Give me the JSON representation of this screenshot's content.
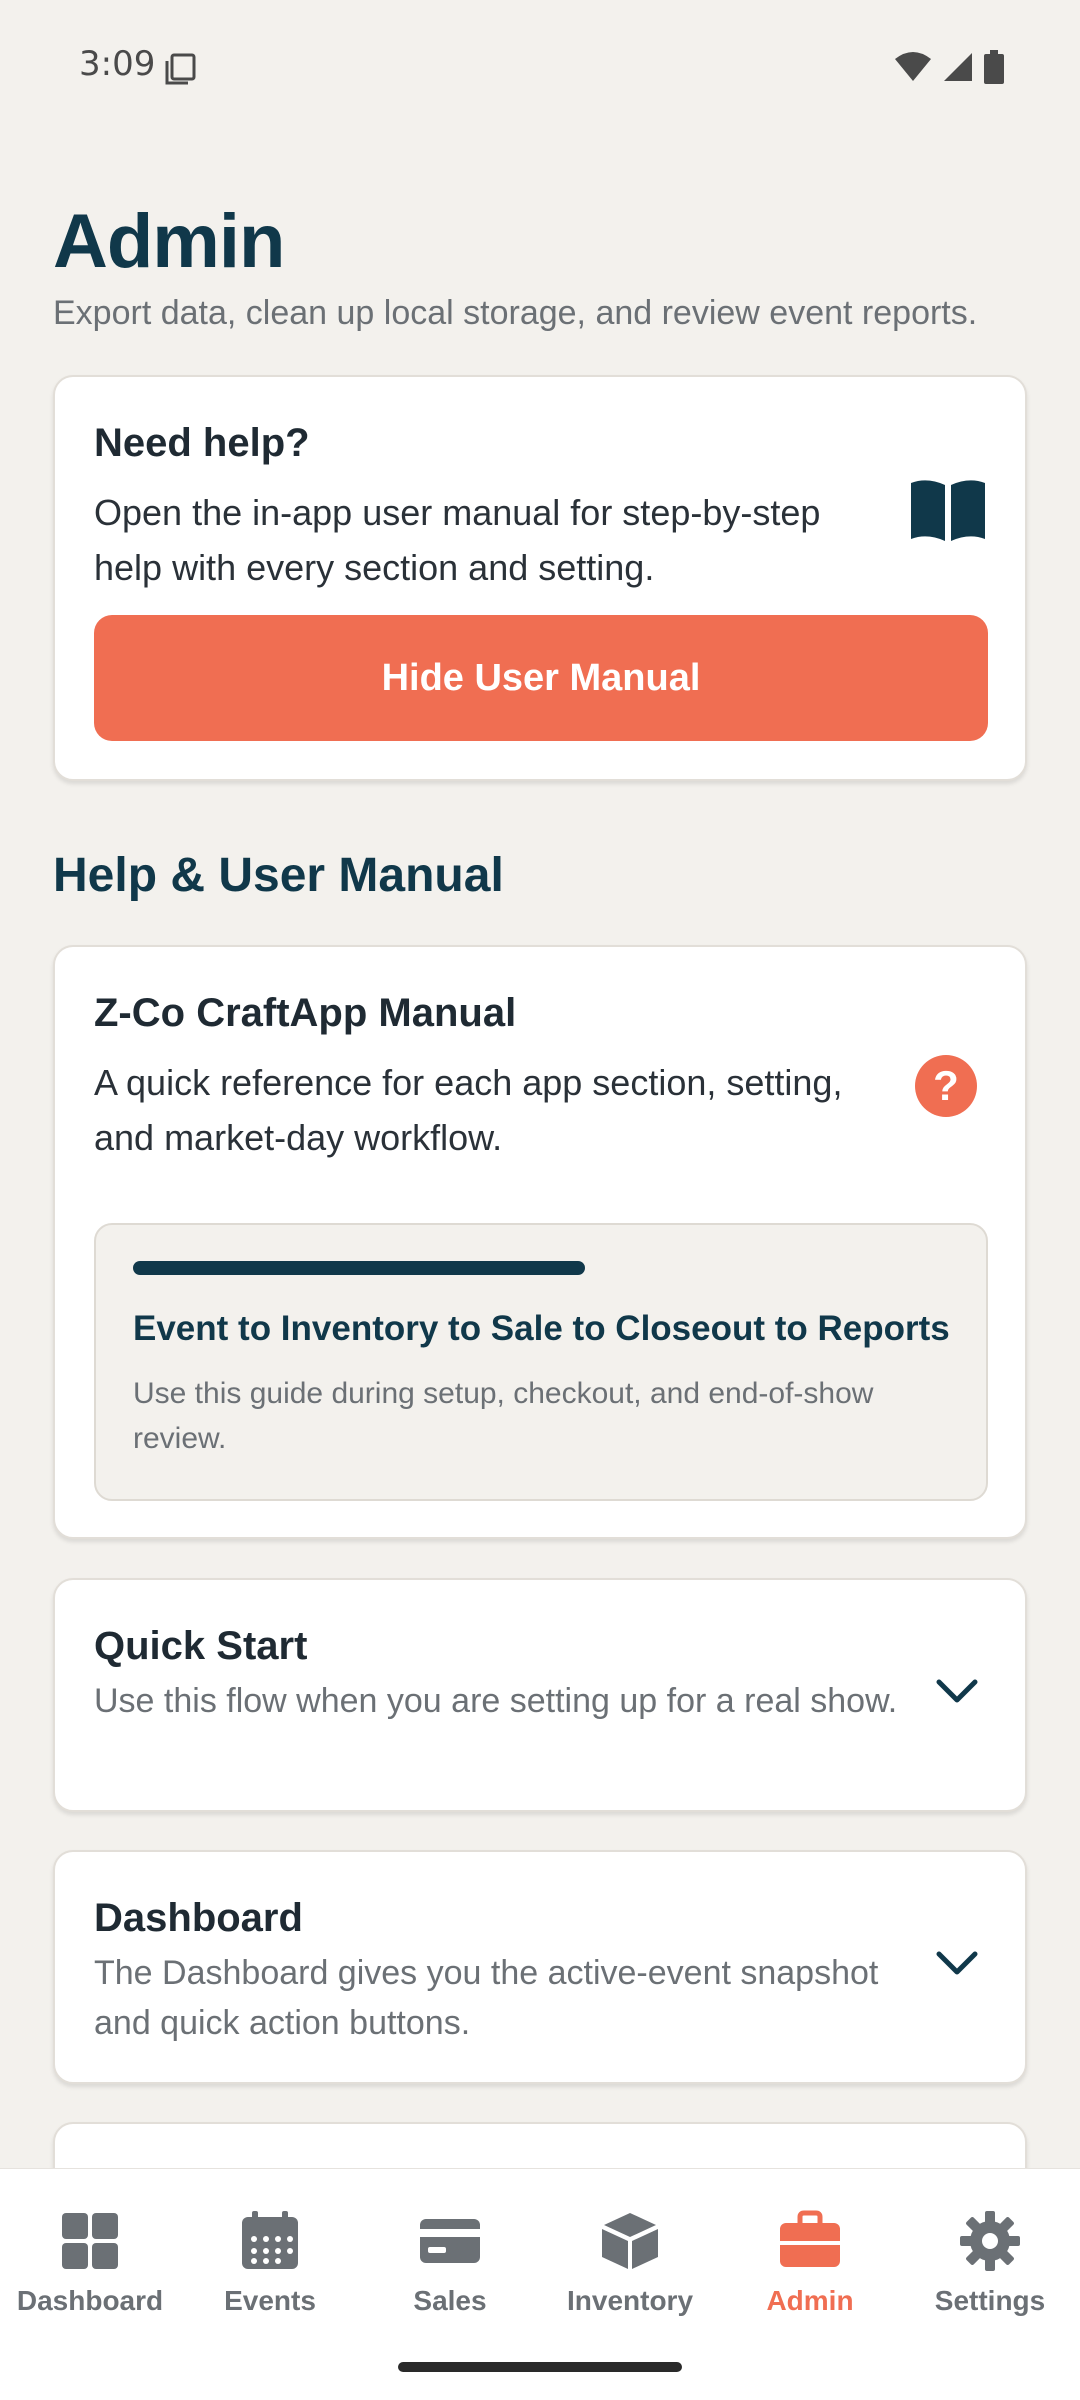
{
  "status": {
    "time": "3:09"
  },
  "header": {
    "title": "Admin",
    "subtitle": "Export data, clean up local storage, and review event reports."
  },
  "help_card": {
    "title": "Need help?",
    "text": "Open the in-app user manual for step-by-step help with every section and setting.",
    "button_label": "Hide User Manual"
  },
  "section_heading": "Help & User Manual",
  "manual_card": {
    "title": "Z-Co CraftApp Manual",
    "text": "A quick reference for each app section, setting, and market-day workflow.",
    "workflow_title": "Event to Inventory to Sale to Closeout to Reports",
    "workflow_text": "Use this guide during setup, checkout, and end-of-show review."
  },
  "accordions": [
    {
      "title": "Quick Start",
      "text": "Use this flow when you are setting up for a real show."
    },
    {
      "title": "Dashboard",
      "text": "The Dashboard gives you the active-event snapshot and quick action buttons."
    }
  ],
  "nav": [
    {
      "label": "Dashboard",
      "icon": "dashboard-grid-icon",
      "active": false
    },
    {
      "label": "Events",
      "icon": "calendar-icon",
      "active": false
    },
    {
      "label": "Sales",
      "icon": "card-icon",
      "active": false
    },
    {
      "label": "Inventory",
      "icon": "box-icon",
      "active": false
    },
    {
      "label": "Admin",
      "icon": "briefcase-icon",
      "active": true
    },
    {
      "label": "Settings",
      "icon": "gear-icon",
      "active": false
    }
  ],
  "colors": {
    "accent": "#f06e52",
    "primary": "#10384a",
    "background": "#f3f1ed"
  }
}
